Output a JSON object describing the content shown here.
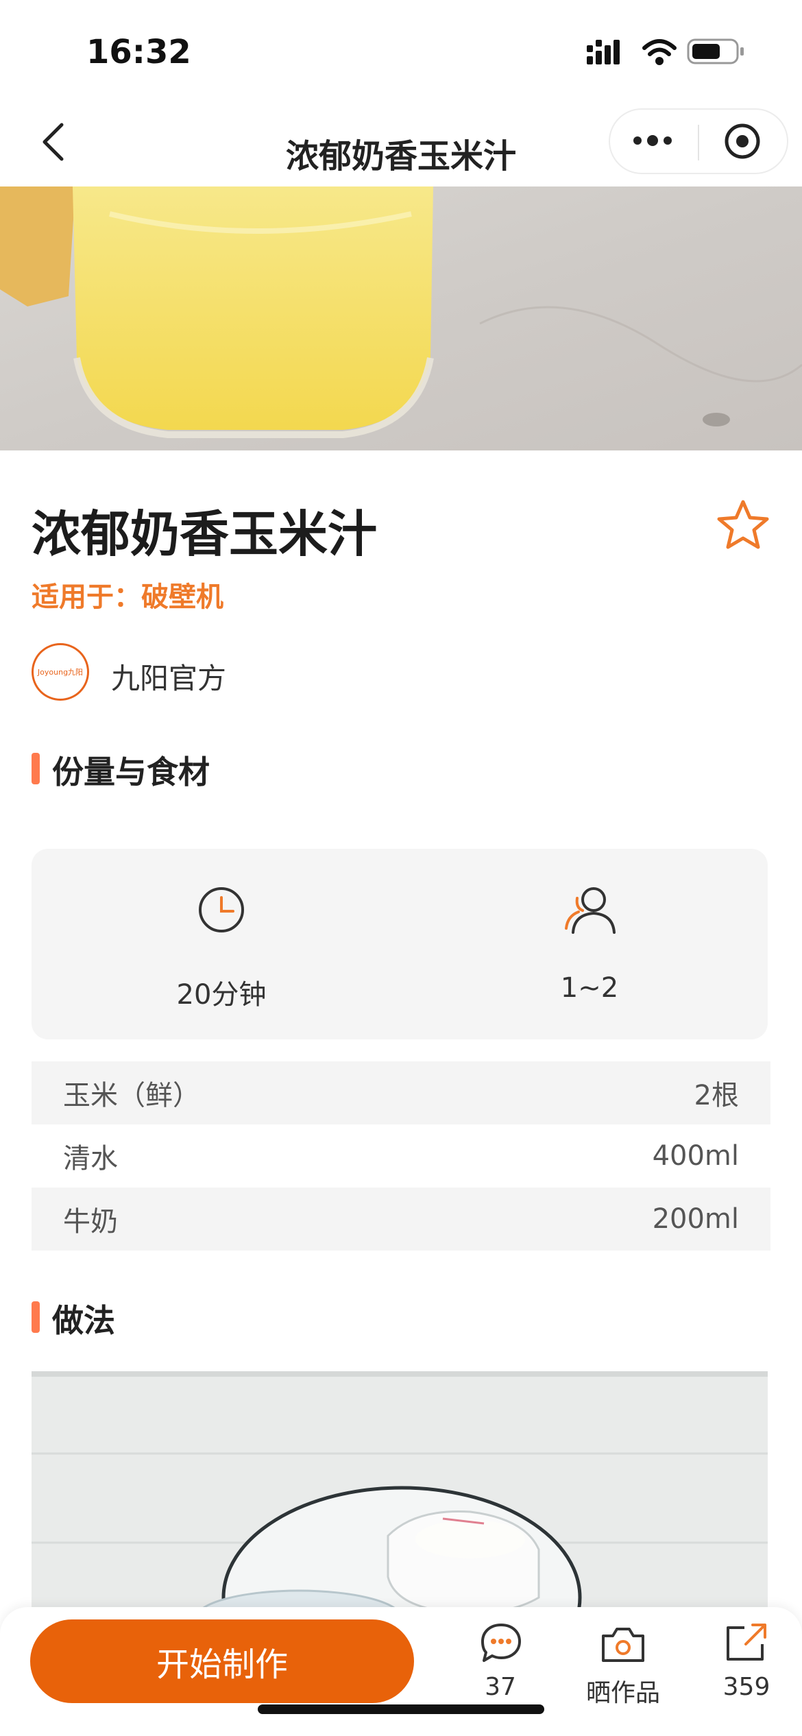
{
  "status_bar": {
    "time": "16:32"
  },
  "nav": {
    "title": "浓郁奶香玉米汁"
  },
  "recipe": {
    "title": "浓郁奶香玉米汁",
    "applies_to": "适用于：破壁机",
    "author": {
      "name": "九阳官方",
      "logo_text": "Joyoung九阳"
    }
  },
  "sections": {
    "ingredients": "份量与食材",
    "method": "做法"
  },
  "info": {
    "time": "20分钟",
    "servings": "1~2"
  },
  "ingredients": [
    {
      "name": "玉米（鲜）",
      "amount": "2根"
    },
    {
      "name": "清水",
      "amount": "400ml"
    },
    {
      "name": "牛奶",
      "amount": "200ml"
    }
  ],
  "bottom_bar": {
    "start_label": "开始制作",
    "comments_count": "37",
    "works_label": "晒作品",
    "share_count": "359"
  },
  "colors": {
    "accent": "#e8620a",
    "orange_text": "#ef7a2a",
    "section_bar": "#ff7a4d"
  }
}
